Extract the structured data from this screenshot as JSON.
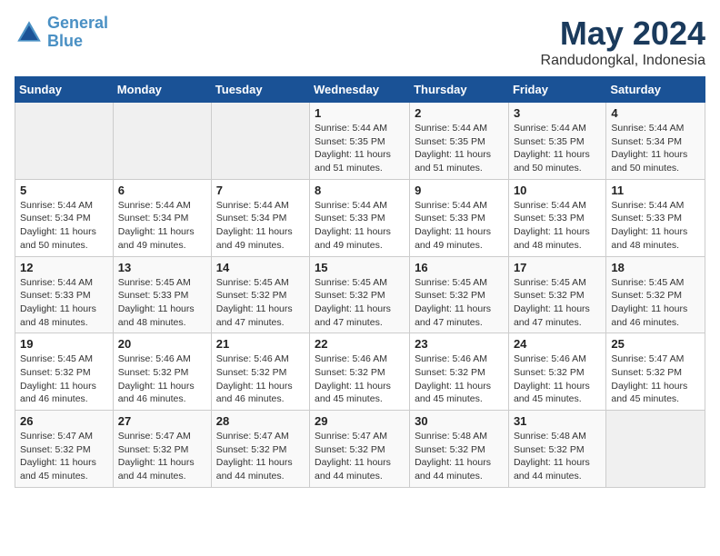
{
  "header": {
    "logo_line1": "General",
    "logo_line2": "Blue",
    "month": "May 2024",
    "location": "Randudongkal, Indonesia"
  },
  "weekdays": [
    "Sunday",
    "Monday",
    "Tuesday",
    "Wednesday",
    "Thursday",
    "Friday",
    "Saturday"
  ],
  "weeks": [
    [
      {
        "day": "",
        "sunrise": "",
        "sunset": "",
        "daylight": ""
      },
      {
        "day": "",
        "sunrise": "",
        "sunset": "",
        "daylight": ""
      },
      {
        "day": "",
        "sunrise": "",
        "sunset": "",
        "daylight": ""
      },
      {
        "day": "1",
        "sunrise": "Sunrise: 5:44 AM",
        "sunset": "Sunset: 5:35 PM",
        "daylight": "Daylight: 11 hours and 51 minutes."
      },
      {
        "day": "2",
        "sunrise": "Sunrise: 5:44 AM",
        "sunset": "Sunset: 5:35 PM",
        "daylight": "Daylight: 11 hours and 51 minutes."
      },
      {
        "day": "3",
        "sunrise": "Sunrise: 5:44 AM",
        "sunset": "Sunset: 5:35 PM",
        "daylight": "Daylight: 11 hours and 50 minutes."
      },
      {
        "day": "4",
        "sunrise": "Sunrise: 5:44 AM",
        "sunset": "Sunset: 5:34 PM",
        "daylight": "Daylight: 11 hours and 50 minutes."
      }
    ],
    [
      {
        "day": "5",
        "sunrise": "Sunrise: 5:44 AM",
        "sunset": "Sunset: 5:34 PM",
        "daylight": "Daylight: 11 hours and 50 minutes."
      },
      {
        "day": "6",
        "sunrise": "Sunrise: 5:44 AM",
        "sunset": "Sunset: 5:34 PM",
        "daylight": "Daylight: 11 hours and 49 minutes."
      },
      {
        "day": "7",
        "sunrise": "Sunrise: 5:44 AM",
        "sunset": "Sunset: 5:34 PM",
        "daylight": "Daylight: 11 hours and 49 minutes."
      },
      {
        "day": "8",
        "sunrise": "Sunrise: 5:44 AM",
        "sunset": "Sunset: 5:33 PM",
        "daylight": "Daylight: 11 hours and 49 minutes."
      },
      {
        "day": "9",
        "sunrise": "Sunrise: 5:44 AM",
        "sunset": "Sunset: 5:33 PM",
        "daylight": "Daylight: 11 hours and 49 minutes."
      },
      {
        "day": "10",
        "sunrise": "Sunrise: 5:44 AM",
        "sunset": "Sunset: 5:33 PM",
        "daylight": "Daylight: 11 hours and 48 minutes."
      },
      {
        "day": "11",
        "sunrise": "Sunrise: 5:44 AM",
        "sunset": "Sunset: 5:33 PM",
        "daylight": "Daylight: 11 hours and 48 minutes."
      }
    ],
    [
      {
        "day": "12",
        "sunrise": "Sunrise: 5:44 AM",
        "sunset": "Sunset: 5:33 PM",
        "daylight": "Daylight: 11 hours and 48 minutes."
      },
      {
        "day": "13",
        "sunrise": "Sunrise: 5:45 AM",
        "sunset": "Sunset: 5:33 PM",
        "daylight": "Daylight: 11 hours and 48 minutes."
      },
      {
        "day": "14",
        "sunrise": "Sunrise: 5:45 AM",
        "sunset": "Sunset: 5:32 PM",
        "daylight": "Daylight: 11 hours and 47 minutes."
      },
      {
        "day": "15",
        "sunrise": "Sunrise: 5:45 AM",
        "sunset": "Sunset: 5:32 PM",
        "daylight": "Daylight: 11 hours and 47 minutes."
      },
      {
        "day": "16",
        "sunrise": "Sunrise: 5:45 AM",
        "sunset": "Sunset: 5:32 PM",
        "daylight": "Daylight: 11 hours and 47 minutes."
      },
      {
        "day": "17",
        "sunrise": "Sunrise: 5:45 AM",
        "sunset": "Sunset: 5:32 PM",
        "daylight": "Daylight: 11 hours and 47 minutes."
      },
      {
        "day": "18",
        "sunrise": "Sunrise: 5:45 AM",
        "sunset": "Sunset: 5:32 PM",
        "daylight": "Daylight: 11 hours and 46 minutes."
      }
    ],
    [
      {
        "day": "19",
        "sunrise": "Sunrise: 5:45 AM",
        "sunset": "Sunset: 5:32 PM",
        "daylight": "Daylight: 11 hours and 46 minutes."
      },
      {
        "day": "20",
        "sunrise": "Sunrise: 5:46 AM",
        "sunset": "Sunset: 5:32 PM",
        "daylight": "Daylight: 11 hours and 46 minutes."
      },
      {
        "day": "21",
        "sunrise": "Sunrise: 5:46 AM",
        "sunset": "Sunset: 5:32 PM",
        "daylight": "Daylight: 11 hours and 46 minutes."
      },
      {
        "day": "22",
        "sunrise": "Sunrise: 5:46 AM",
        "sunset": "Sunset: 5:32 PM",
        "daylight": "Daylight: 11 hours and 45 minutes."
      },
      {
        "day": "23",
        "sunrise": "Sunrise: 5:46 AM",
        "sunset": "Sunset: 5:32 PM",
        "daylight": "Daylight: 11 hours and 45 minutes."
      },
      {
        "day": "24",
        "sunrise": "Sunrise: 5:46 AM",
        "sunset": "Sunset: 5:32 PM",
        "daylight": "Daylight: 11 hours and 45 minutes."
      },
      {
        "day": "25",
        "sunrise": "Sunrise: 5:47 AM",
        "sunset": "Sunset: 5:32 PM",
        "daylight": "Daylight: 11 hours and 45 minutes."
      }
    ],
    [
      {
        "day": "26",
        "sunrise": "Sunrise: 5:47 AM",
        "sunset": "Sunset: 5:32 PM",
        "daylight": "Daylight: 11 hours and 45 minutes."
      },
      {
        "day": "27",
        "sunrise": "Sunrise: 5:47 AM",
        "sunset": "Sunset: 5:32 PM",
        "daylight": "Daylight: 11 hours and 44 minutes."
      },
      {
        "day": "28",
        "sunrise": "Sunrise: 5:47 AM",
        "sunset": "Sunset: 5:32 PM",
        "daylight": "Daylight: 11 hours and 44 minutes."
      },
      {
        "day": "29",
        "sunrise": "Sunrise: 5:47 AM",
        "sunset": "Sunset: 5:32 PM",
        "daylight": "Daylight: 11 hours and 44 minutes."
      },
      {
        "day": "30",
        "sunrise": "Sunrise: 5:48 AM",
        "sunset": "Sunset: 5:32 PM",
        "daylight": "Daylight: 11 hours and 44 minutes."
      },
      {
        "day": "31",
        "sunrise": "Sunrise: 5:48 AM",
        "sunset": "Sunset: 5:32 PM",
        "daylight": "Daylight: 11 hours and 44 minutes."
      },
      {
        "day": "",
        "sunrise": "",
        "sunset": "",
        "daylight": ""
      }
    ]
  ]
}
